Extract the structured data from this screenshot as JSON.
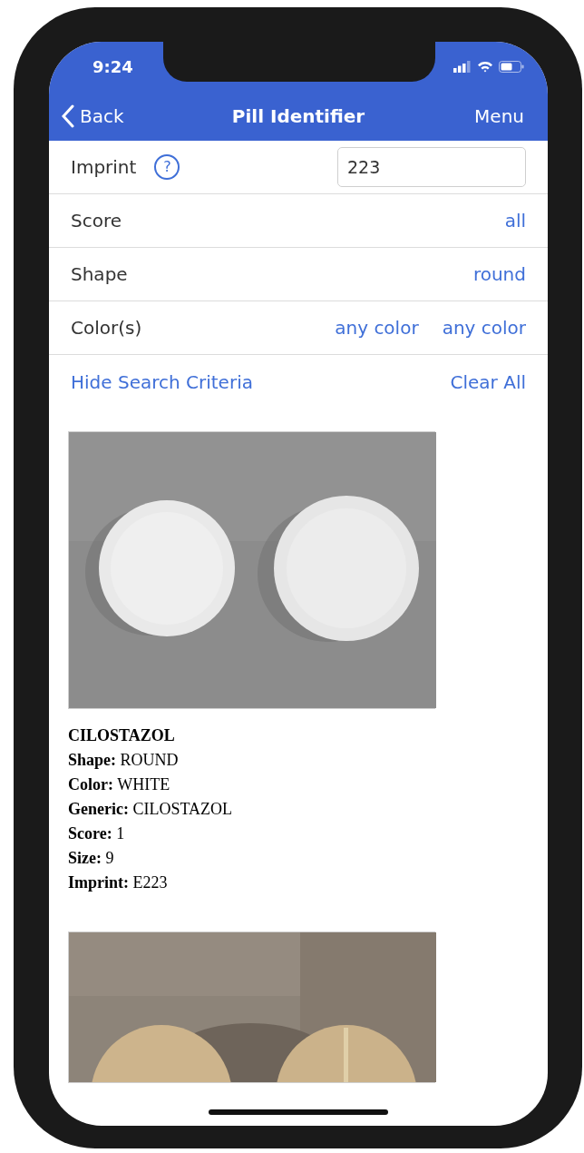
{
  "status_bar": {
    "time": "9:24"
  },
  "nav": {
    "back": "Back",
    "title": "Pill Identifier",
    "menu": "Menu"
  },
  "criteria": [
    {
      "kind": "input",
      "label": "Imprint",
      "help": "?",
      "value": "223"
    },
    {
      "kind": "choice",
      "label": "Score",
      "values": [
        "all"
      ]
    },
    {
      "kind": "choice",
      "label": "Shape",
      "values": [
        "round"
      ]
    },
    {
      "kind": "choice",
      "label": "Color(s)",
      "values": [
        "any color",
        "any color"
      ]
    }
  ],
  "actions": {
    "hide": "Hide Search Criteria",
    "clear": "Clear All"
  },
  "results": [
    {
      "kind": "picture",
      "name": "CILOSTAZOL",
      "details": [
        "**Shape:** ROUND",
        "**Color:** WHITE",
        "**Generic:** CILOSTAZOL",
        "**Score:** 1",
        "**Size:** 9",
        "**Imprint:** E223"
      ]
    },
    {
      "kind": "picture"
    }
  ]
}
